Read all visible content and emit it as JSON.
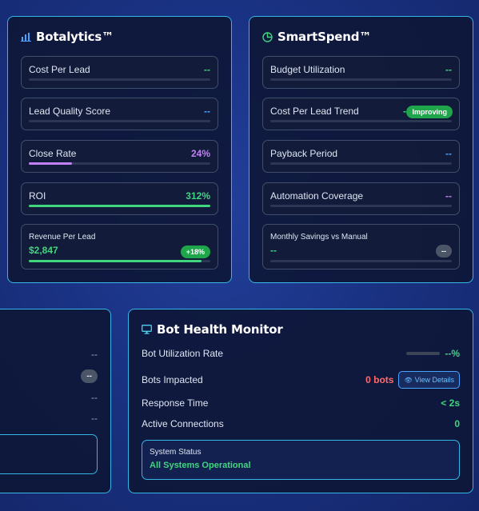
{
  "botalytics": {
    "title": "Botalytics™",
    "icon": "bar-chart-icon",
    "metrics": [
      {
        "label": "Cost Per Lead",
        "value": "--",
        "progress": 0
      },
      {
        "label": "Lead Quality Score",
        "value": "--",
        "progress": 0
      },
      {
        "label": "Close Rate",
        "value": "24%",
        "progress": 0.24
      },
      {
        "label": "ROI",
        "value": "312%",
        "progress": 1.0
      }
    ],
    "revenue": {
      "label": "Revenue Per Lead",
      "value": "$2,847",
      "badge": "+18%",
      "progress": 0.95
    }
  },
  "smartspend": {
    "title": "SmartSpend™",
    "icon": "pie-chart-icon",
    "metrics": [
      {
        "label": "Budget Utilization",
        "value": "--"
      },
      {
        "label": "Cost Per Lead Trend",
        "value": "--",
        "badge": "Improving"
      },
      {
        "label": "Payback Period",
        "value": "--"
      },
      {
        "label": "Automation Coverage",
        "value": "--"
      }
    ],
    "savings": {
      "label": "Monthly Savings vs Manual",
      "value": "--",
      "badge": "--"
    }
  },
  "left_panel": {
    "values": [
      "--",
      "--",
      "--",
      "--"
    ]
  },
  "bot_health": {
    "title": "Bot Health Monitor",
    "icon": "monitor-icon",
    "utilization": {
      "label": "Bot Utilization Rate",
      "value": "--%"
    },
    "impacted": {
      "label": "Bots Impacted",
      "value": "0 bots",
      "button": "View Details"
    },
    "response": {
      "label": "Response Time",
      "value": "< 2s"
    },
    "connections": {
      "label": "Active Connections",
      "value": "0"
    },
    "status": {
      "label": "System Status",
      "value": "All Systems Operational"
    }
  },
  "colors": {
    "accent_border": "#35b6e6",
    "green": "#3fd67e",
    "blue": "#4aa3ff",
    "purple": "#c281f5",
    "red": "#ff6b6b",
    "badge_green": "#1fa64b"
  }
}
